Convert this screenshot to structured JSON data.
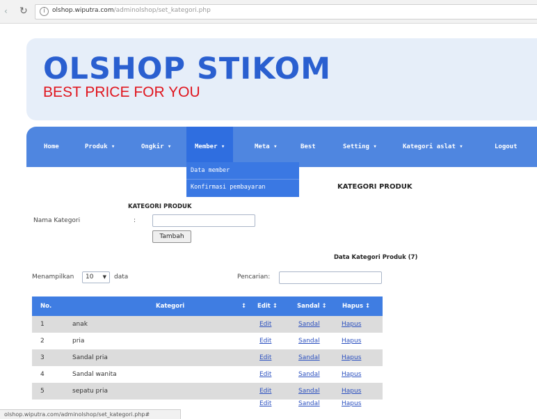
{
  "browser": {
    "url_host": "olshop.wiputra.com",
    "url_path": "/adminolshop/set_kategori.php"
  },
  "header": {
    "title": "OLSHOP STIKOM",
    "tagline": "BEST PRICE FOR YOU"
  },
  "nav": {
    "items": [
      {
        "label": "Home"
      },
      {
        "label": "Produk ▾"
      },
      {
        "label": "Ongkir ▾"
      },
      {
        "label": "Member ▾"
      },
      {
        "label": "Meta ▾"
      },
      {
        "label": "Best"
      },
      {
        "label": "Setting ▾"
      },
      {
        "label": "Kategori aslat ▾"
      },
      {
        "label": "Logout"
      }
    ],
    "dropdown": [
      {
        "label": "Data member"
      },
      {
        "label": "Konfirmasi pembayaran"
      }
    ]
  },
  "page": {
    "title": "KATEGORI PRODUK",
    "form_title": "KATEGORI PRODUK",
    "name_label": "Nama Kategori",
    "colon": ":",
    "add_button": "Tambah",
    "data_title": "Data Kategori Produk (7)",
    "show_prefix": "Menampilkan",
    "show_value": "10",
    "show_suffix": "data",
    "search_label": "Pencarian:"
  },
  "table": {
    "headers": [
      "No.",
      "Kategori",
      "↕",
      "Edit ↕",
      "Sandal ↕",
      "Hapus ↕"
    ],
    "rows": [
      {
        "no": "1",
        "kategori": "anak",
        "edit": "Edit",
        "sandal": "Sandal",
        "hapus": "Hapus"
      },
      {
        "no": "2",
        "kategori": "pria",
        "edit": "Edit",
        "sandal": "Sandal",
        "hapus": "Hapus"
      },
      {
        "no": "3",
        "kategori": "Sandal pria",
        "edit": "Edit",
        "sandal": "Sandal",
        "hapus": "Hapus"
      },
      {
        "no": "4",
        "kategori": "Sandal wanita",
        "edit": "Edit",
        "sandal": "Sandal",
        "hapus": "Hapus"
      },
      {
        "no": "5",
        "kategori": "sepatu pria",
        "edit": "Edit",
        "sandal": "Sandal",
        "hapus": "Hapus"
      },
      {
        "no": "",
        "kategori": "",
        "edit": "Edit",
        "sandal": "Sandal",
        "hapus": "Hapus"
      }
    ]
  },
  "status": {
    "text": "olshop.wiputra.com/adminolshop/set_kategori.php#"
  },
  "colors": {
    "accent": "#4f86e0",
    "logo": "#2a5fd0",
    "tagline": "#e0141d"
  }
}
